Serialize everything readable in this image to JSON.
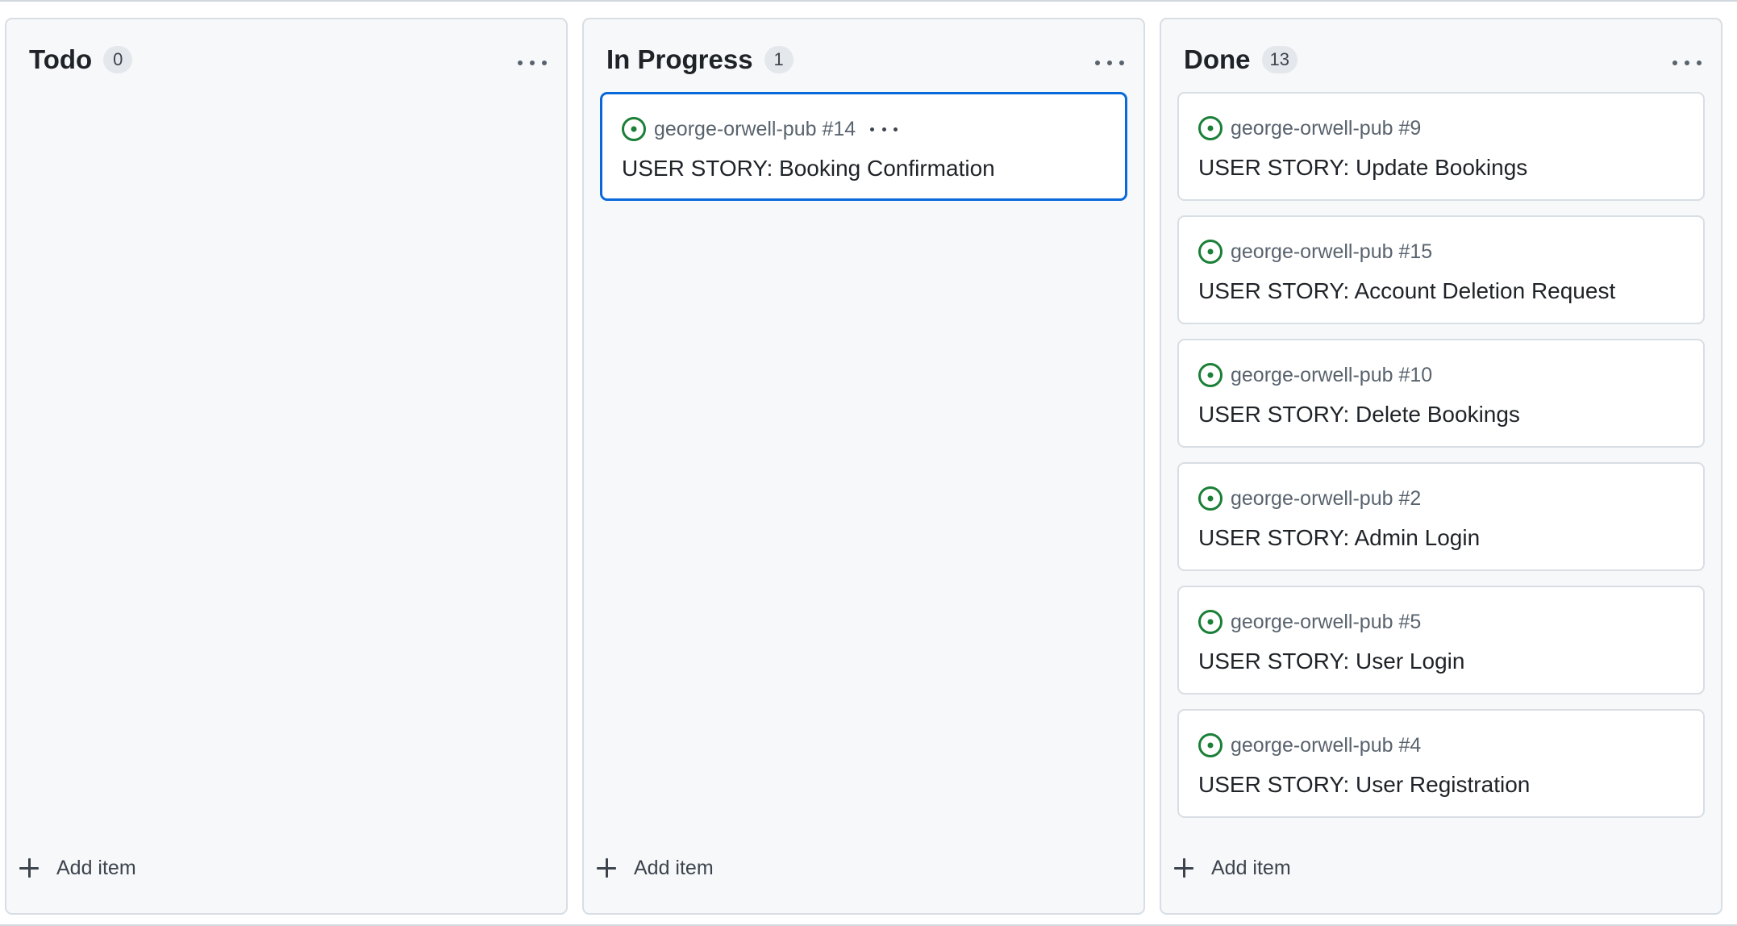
{
  "columns": [
    {
      "title": "Todo",
      "count": "0",
      "add_label": "Add item",
      "cards": []
    },
    {
      "title": "In Progress",
      "count": "1",
      "add_label": "Add item",
      "cards": [
        {
          "repo": "george-orwell-pub #14",
          "title": "USER STORY: Booking Confirmation",
          "selected": true
        }
      ]
    },
    {
      "title": "Done",
      "count": "13",
      "add_label": "Add item",
      "cards": [
        {
          "repo": "george-orwell-pub #9",
          "title": "USER STORY: Update Bookings"
        },
        {
          "repo": "george-orwell-pub #15",
          "title": "USER STORY: Account Deletion Request"
        },
        {
          "repo": "george-orwell-pub #10",
          "title": "USER STORY: Delete Bookings"
        },
        {
          "repo": "george-orwell-pub #2",
          "title": "USER STORY: Admin Login"
        },
        {
          "repo": "george-orwell-pub #5",
          "title": "USER STORY: User Login"
        },
        {
          "repo": "george-orwell-pub #4",
          "title": "USER STORY: User Registration"
        },
        {
          "repo": "",
          "title": ""
        }
      ]
    }
  ],
  "icons": {
    "issue": "issue-opened-icon",
    "menu": "kebab-horizontal-icon",
    "add": "plus-icon"
  },
  "colors": {
    "accent": "#0969da",
    "open_issue": "#1a7f37"
  }
}
